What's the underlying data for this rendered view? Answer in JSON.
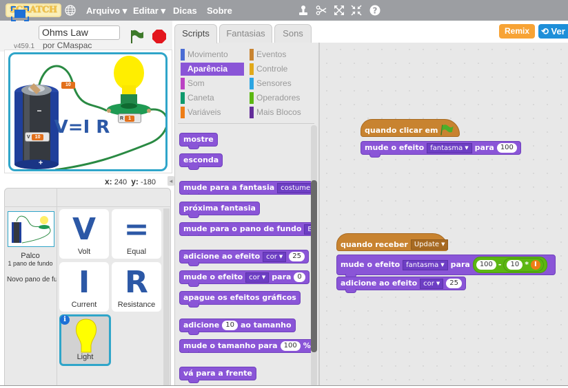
{
  "topbar": {
    "logo": "SCRATCH",
    "menu": [
      {
        "label": "Arquivo ▾"
      },
      {
        "label": "Editar ▾"
      },
      {
        "label": "Dicas"
      },
      {
        "label": "Sobre"
      }
    ],
    "tools": [
      "duplicate-stamp-icon",
      "cut-scissors-icon",
      "grow-icon",
      "shrink-icon",
      "help-icon"
    ]
  },
  "project": {
    "title": "Ohms Law",
    "author": "por CMaspac",
    "version": "v459.1"
  },
  "stage": {
    "equation": "V=I R",
    "monitors": {
      "wire_value": "10",
      "battery_label": "V",
      "battery_value": "10",
      "bulb_label": "R",
      "bulb_value": "1"
    },
    "battery_minus": "−",
    "battery_plus": "+",
    "mouse_x_label": "x:",
    "mouse_x": "240",
    "mouse_y_label": "y:",
    "mouse_y": "-180"
  },
  "sprites_pane": {
    "stage_name": "Palco",
    "stage_backdrops": "1 pano de fundo",
    "new_backdrop": "Novo pano de fundo:",
    "sprites": [
      {
        "name": "Volt",
        "glyph": "V"
      },
      {
        "name": "Equal",
        "glyph": "="
      },
      {
        "name": "Current",
        "glyph": "I"
      },
      {
        "name": "Resistance",
        "glyph": "R"
      },
      {
        "name": "Light",
        "glyph": "",
        "selected": true
      }
    ],
    "info_badge": "i"
  },
  "tabs": [
    {
      "label": "Scripts",
      "active": true
    },
    {
      "label": "Fantasias"
    },
    {
      "label": "Sons"
    }
  ],
  "actions": {
    "remix": "Remix",
    "see_inside": "Ver"
  },
  "categories": [
    {
      "label": "Movimento",
      "color": "#4a6cd4"
    },
    {
      "label": "Aparência",
      "color": "#8a55d7",
      "active": true
    },
    {
      "label": "Som",
      "color": "#bb42c3"
    },
    {
      "label": "Caneta",
      "color": "#0e9a6c"
    },
    {
      "label": "Variáveis",
      "color": "#ee7d16"
    },
    {
      "label": "Eventos",
      "color": "#c88330"
    },
    {
      "label": "Controle",
      "color": "#e1a91a"
    },
    {
      "label": "Sensores",
      "color": "#2ca5e2"
    },
    {
      "label": "Operadores",
      "color": "#5cb712"
    },
    {
      "label": "Mais Blocos",
      "color": "#632d99"
    }
  ],
  "palette_blocks": {
    "show": "mostre",
    "hide": "esconda",
    "switch_costume": "mude para a fantasia",
    "switch_costume_value": "costume",
    "next_costume": "próxima fantasia",
    "switch_backdrop": "mude para o pano de fundo",
    "switch_backdrop_value": "B",
    "change_effect": "adicione ao efeito",
    "change_effect_dd": "cor",
    "change_effect_val": "25",
    "set_effect": "mude o efeito",
    "set_effect_dd": "cor",
    "set_effect_para": "para",
    "set_effect_val": "0",
    "clear_effects": "apague os efeitos gráficos",
    "change_size_a": "adicione",
    "change_size_val": "10",
    "change_size_b": "ao tamanho",
    "set_size": "mude o tamanho para",
    "set_size_val": "100",
    "set_size_unit": "%",
    "go_front": "vá para a frente"
  },
  "scripts": [
    {
      "hat": "quando clicar em",
      "hat_icon": "green-flag-icon",
      "block_label": "mude o efeito",
      "block_dd": "fantasma",
      "block_para": "para",
      "block_val": "100"
    },
    {
      "hat": "quando receber",
      "hat_dd": "Update",
      "block1_label": "mude o efeito",
      "block1_dd": "fantasma",
      "block1_para": "para",
      "op_a": "100",
      "op_minus": "-",
      "op_b": "10",
      "op_times": "*",
      "op_var": "I",
      "block2_label": "adicione ao efeito",
      "block2_dd": "cor",
      "block2_val": "25"
    }
  ]
}
